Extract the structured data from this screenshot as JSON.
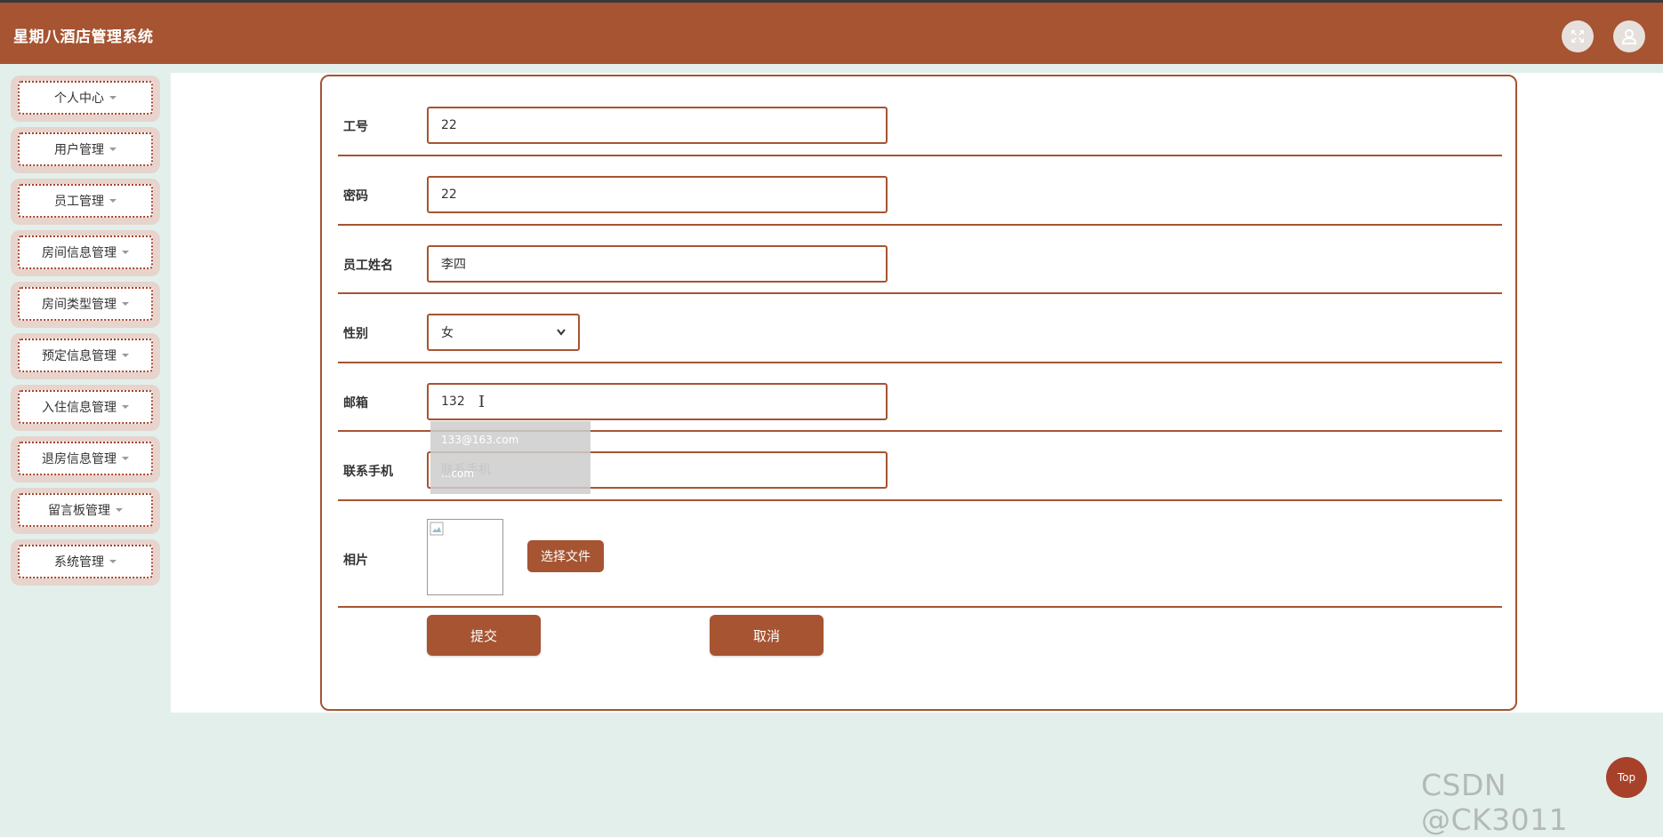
{
  "app": {
    "title": "星期八酒店管理系统"
  },
  "sidebar": {
    "items": [
      {
        "label": "个人中心"
      },
      {
        "label": "用户管理"
      },
      {
        "label": "员工管理"
      },
      {
        "label": "房间信息管理"
      },
      {
        "label": "房间类型管理"
      },
      {
        "label": "预定信息管理"
      },
      {
        "label": "入住信息管理"
      },
      {
        "label": "退房信息管理"
      },
      {
        "label": "留言板管理"
      },
      {
        "label": "系统管理"
      }
    ]
  },
  "form": {
    "employee_id": {
      "label": "工号",
      "value": "22"
    },
    "password": {
      "label": "密码",
      "value": "22"
    },
    "name": {
      "label": "员工姓名",
      "value": "李四"
    },
    "gender": {
      "label": "性别",
      "value": "女"
    },
    "email": {
      "label": "邮箱",
      "value": "132"
    },
    "phone": {
      "label": "联系手机",
      "value": "",
      "placeholder": "联系手机"
    },
    "photo": {
      "label": "相片",
      "file_button": "选择文件"
    },
    "autocomplete": {
      "suggestions": [
        "133@163.com",
        "...com"
      ]
    },
    "submit_label": "提交",
    "cancel_label": "取消"
  },
  "back_to_top": {
    "label": "Top"
  },
  "watermark": {
    "text": "CSDN @CK3011"
  },
  "colors": {
    "primary": "#a65432",
    "page_bg": "#e3efeb"
  }
}
